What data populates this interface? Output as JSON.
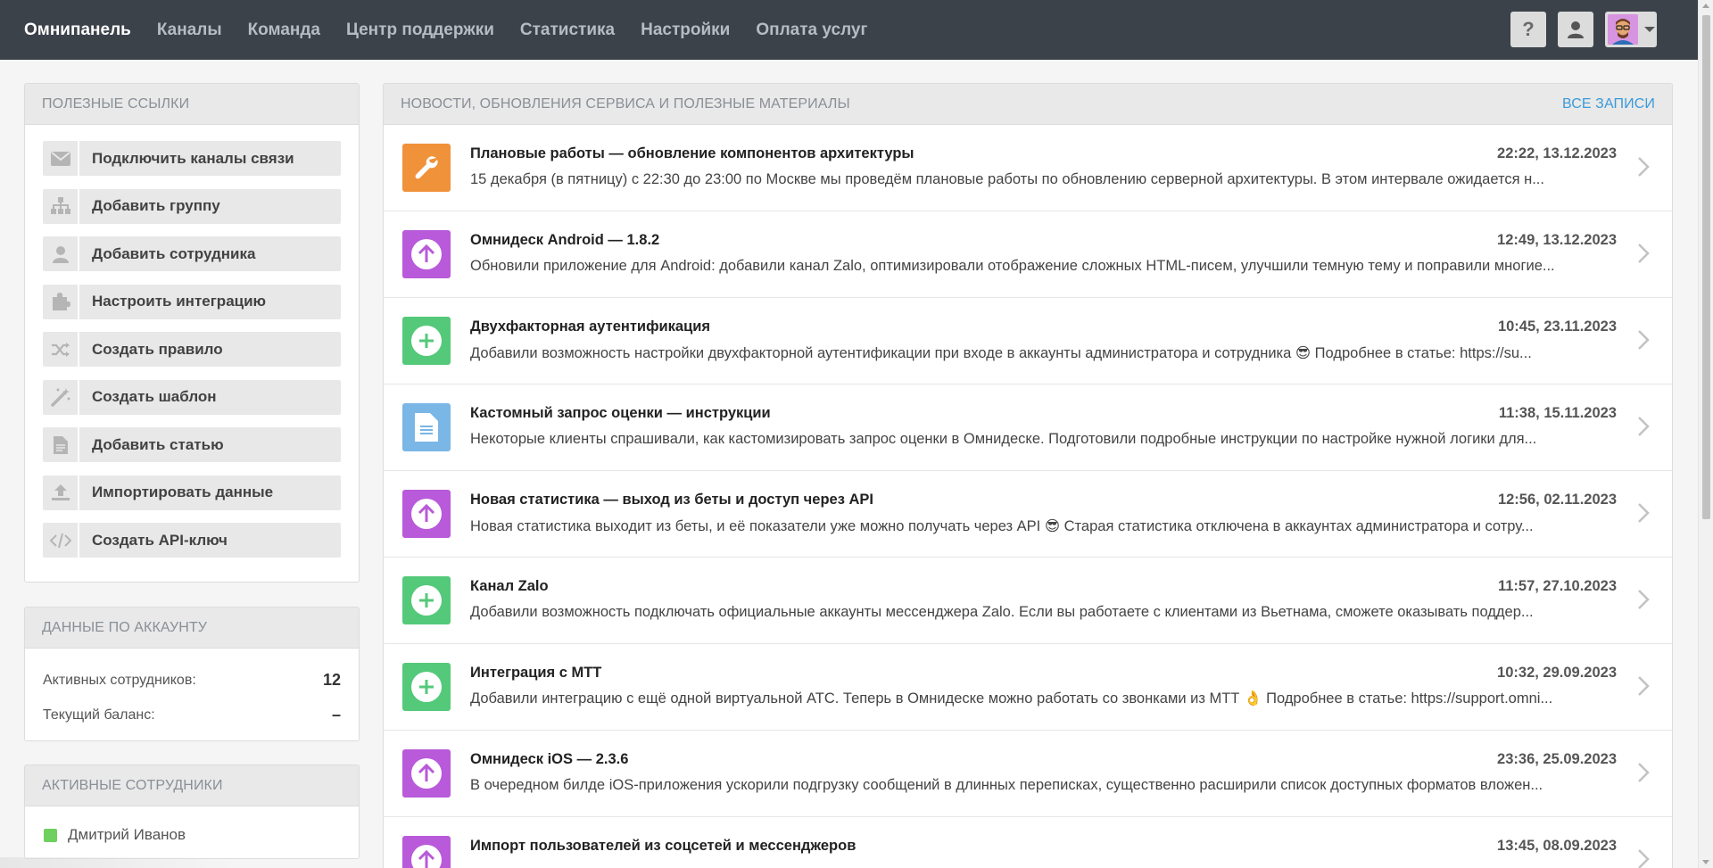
{
  "nav": {
    "items": [
      {
        "label": "Омнипанель",
        "active": true
      },
      {
        "label": "Каналы"
      },
      {
        "label": "Команда"
      },
      {
        "label": "Центр поддержки"
      },
      {
        "label": "Статистика"
      },
      {
        "label": "Настройки"
      },
      {
        "label": "Оплата услуг"
      }
    ],
    "help_label": "?"
  },
  "links": {
    "title": "ПОЛЕЗНЫЕ ССЫЛКИ",
    "items": [
      {
        "label": "Подключить каналы связи",
        "icon": "envelope-icon"
      },
      {
        "label": "Добавить группу",
        "icon": "sitemap-icon"
      },
      {
        "label": "Добавить сотрудника",
        "icon": "user-icon"
      },
      {
        "label": "Настроить интеграцию",
        "icon": "puzzle-icon"
      },
      {
        "label": "Создать правило",
        "icon": "shuffle-icon"
      },
      {
        "label": "Создать шаблон",
        "icon": "magic-wand-icon"
      },
      {
        "label": "Добавить статью",
        "icon": "document-icon"
      },
      {
        "label": "Импортировать данные",
        "icon": "upload-icon"
      },
      {
        "label": "Создать API-ключ",
        "icon": "code-icon"
      }
    ]
  },
  "account": {
    "title": "ДАННЫЕ ПО АККАУНТУ",
    "active_staff_label": "Активных сотрудников:",
    "active_staff_value": "12",
    "balance_label": "Текущий баланс:",
    "balance_value": "–"
  },
  "staff": {
    "title": "АКТИВНЫЕ СОТРУДНИКИ",
    "members": [
      {
        "name": "Дмитрий Иванов",
        "status_color": "#6fcf5f"
      }
    ]
  },
  "news": {
    "title": "НОВОСТИ, ОБНОВЛЕНИЯ СЕРВИСА И ПОЛЕЗНЫЕ МАТЕРИАЛЫ",
    "all_label": "ВСЕ ЗАПИСИ",
    "items": [
      {
        "title": "Плановые работы — обновление компонентов архитектуры",
        "date": "22:22, 13.12.2023",
        "text": "15 декабря (в пятницу) с 22:30 до 23:00 по Москве мы проведём плановые работы по обновлению серверной архитектуры. В этом интервале ожидается н...",
        "icon": "wrench-icon",
        "color": "#f0923a"
      },
      {
        "title": "Омнидеск Android — 1.8.2",
        "date": "12:49, 13.12.2023",
        "text": "Обновили приложение для Android: добавили канал Zalo, оптимизировали отображение сложных HTML-писем, улучшили темную тему и поправили многие...",
        "icon": "arrow-up-circle-icon",
        "color": "#b85ad9"
      },
      {
        "title": "Двухфакторная аутентификация",
        "date": "10:45, 23.11.2023",
        "text": "Добавили возможность настройки двухфакторной аутентификации при входе в аккаунты администратора и сотрудника 😎 Подробнее в статье: https://su...",
        "icon": "plus-circle-icon",
        "color": "#54c97a"
      },
      {
        "title": "Кастомный запрос оценки — инструкции",
        "date": "11:38, 15.11.2023",
        "text": "Некоторые клиенты спрашивали, как кастомизировать запрос оценки в Омнидеске. Подготовили подробные инструкции по настройке нужной логики для...",
        "icon": "document-icon",
        "color": "#7ab6e6"
      },
      {
        "title": "Новая статистика — выход из беты и доступ через API",
        "date": "12:56, 02.11.2023",
        "text": "Новая статистика выходит из беты, и её показатели уже можно получать через API 😎 Старая статистика отключена в аккаунтах администратора и сотру...",
        "icon": "arrow-up-circle-icon",
        "color": "#b85ad9"
      },
      {
        "title": "Канал Zalo",
        "date": "11:57, 27.10.2023",
        "text": "Добавили возможность подключать официальные аккаунты мессенджера Zalo. Если вы работаете с клиентами из Вьетнама, сможете оказывать поддер...",
        "icon": "plus-circle-icon",
        "color": "#54c97a"
      },
      {
        "title": "Интеграция с МТТ",
        "date": "10:32, 29.09.2023",
        "text": "Добавили интеграцию с ещё одной виртуальной АТС. Теперь в Омнидеске можно работать со звонками из МТТ 👌 Подробнее в статье: https://support.omni...",
        "icon": "plus-circle-icon",
        "color": "#54c97a"
      },
      {
        "title": "Омнидеск iOS — 2.3.6",
        "date": "23:36, 25.09.2023",
        "text": "В очередном билде iOS-приложения ускорили подгрузку сообщений в длинных переписках, существенно расширили список доступных форматов вложен...",
        "icon": "arrow-up-circle-icon",
        "color": "#b85ad9"
      },
      {
        "title": "Импорт пользователей из соцсетей и мессенджеров",
        "date": "13:45, 08.09.2023",
        "text": "",
        "icon": "arrow-up-circle-icon",
        "color": "#b85ad9"
      }
    ]
  }
}
